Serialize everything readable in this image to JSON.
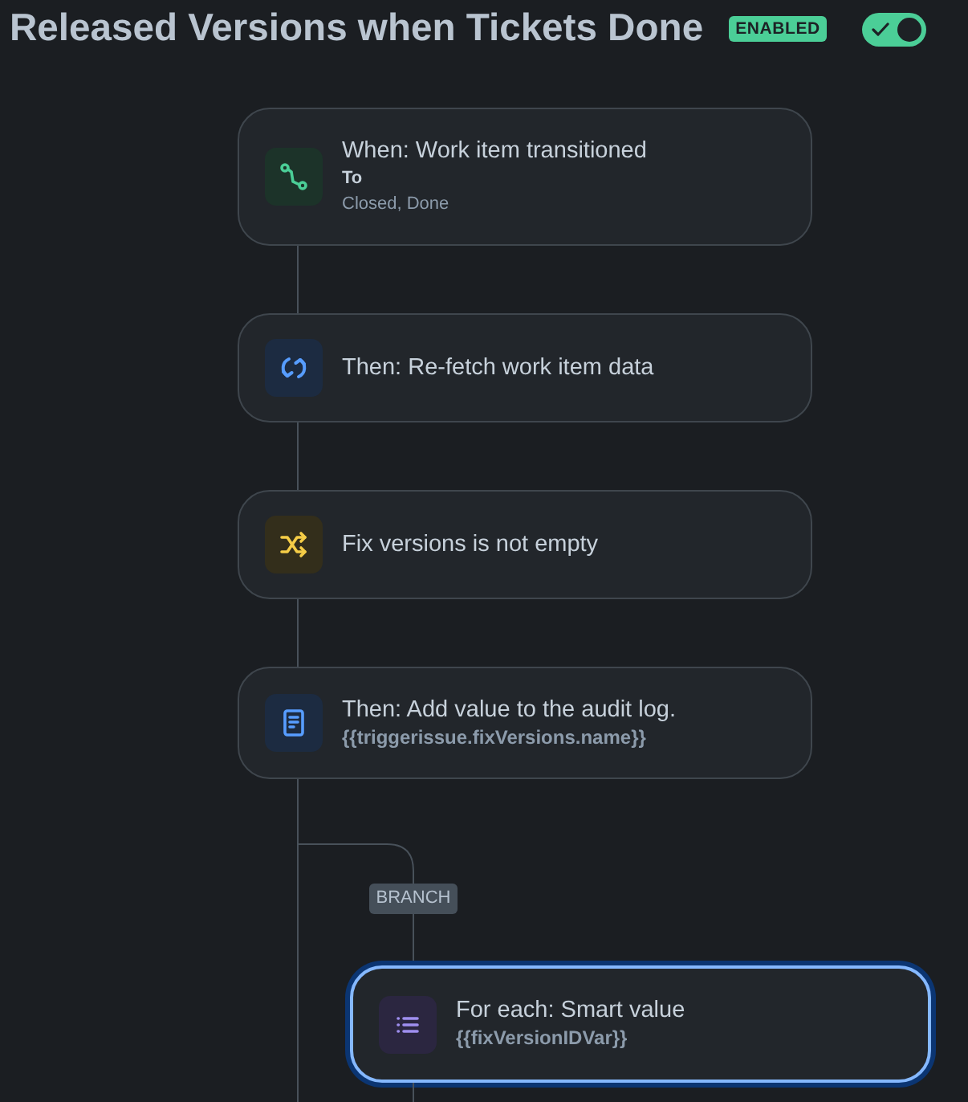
{
  "header": {
    "title": "Released Versions when Tickets Done",
    "status_badge": "ENABLED",
    "toggle": {
      "on": true
    }
  },
  "nodes": [
    {
      "kind": "trigger",
      "title": "When: Work item transitioned",
      "field_label": "To",
      "field_value": "Closed, Done",
      "selected": false
    },
    {
      "kind": "action",
      "title": "Then: Re-fetch work item data",
      "selected": false
    },
    {
      "kind": "condition",
      "title": "Fix versions is not empty",
      "selected": false
    },
    {
      "kind": "log",
      "title": "Then: Add value to the audit log.",
      "expression": "{{triggerissue.fixVersions.name}}",
      "selected": false
    }
  ],
  "branch": {
    "label": "BRANCH",
    "nodes": [
      {
        "kind": "loop",
        "title": "For each: Smart value",
        "expression": "{{fixVersionIDVar}}",
        "selected": true
      }
    ]
  }
}
